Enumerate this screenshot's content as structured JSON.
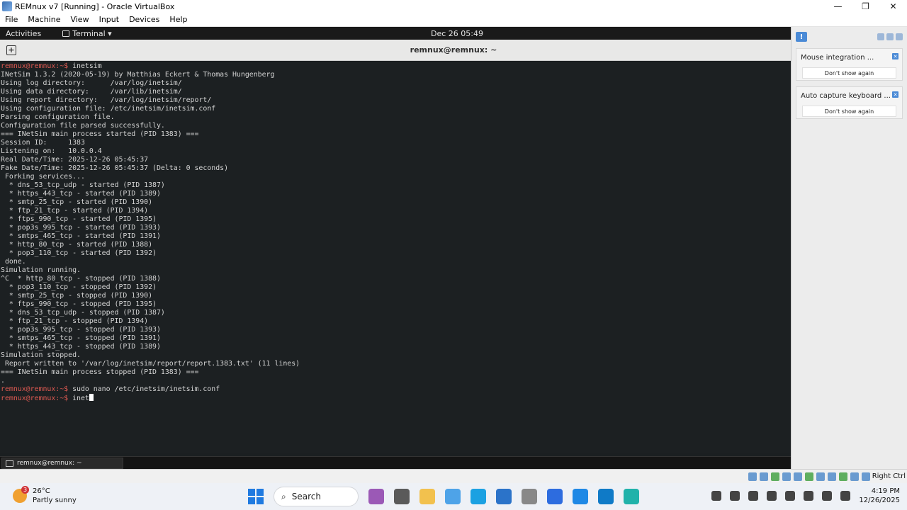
{
  "window": {
    "title": "REMnux v7 [Running] - Oracle VirtualBox",
    "controls": [
      "—",
      "❐",
      "✕"
    ]
  },
  "menubar": [
    "File",
    "Machine",
    "View",
    "Input",
    "Devices",
    "Help"
  ],
  "gnome": {
    "activities": "Activities",
    "app_menu": "Terminal ▾",
    "clock": "Dec 26  05:49"
  },
  "terminal": {
    "title": "remnux@remnux: ~",
    "lines": [
      {
        "prompt": "remnux@remnux:~$",
        "text": " inetsim"
      },
      {
        "prompt": "",
        "text": "INetSim 1.3.2 (2020-05-19) by Matthias Eckert & Thomas Hungenberg"
      },
      {
        "prompt": "",
        "text": "Using log directory:      /var/log/inetsim/"
      },
      {
        "prompt": "",
        "text": "Using data directory:     /var/lib/inetsim/"
      },
      {
        "prompt": "",
        "text": "Using report directory:   /var/log/inetsim/report/"
      },
      {
        "prompt": "",
        "text": "Using configuration file: /etc/inetsim/inetsim.conf"
      },
      {
        "prompt": "",
        "text": "Parsing configuration file."
      },
      {
        "prompt": "",
        "text": "Configuration file parsed successfully."
      },
      {
        "prompt": "",
        "text": "=== INetSim main process started (PID 1383) ==="
      },
      {
        "prompt": "",
        "text": "Session ID:     1383"
      },
      {
        "prompt": "",
        "text": "Listening on:   10.0.0.4"
      },
      {
        "prompt": "",
        "text": "Real Date/Time: 2025-12-26 05:45:37"
      },
      {
        "prompt": "",
        "text": "Fake Date/Time: 2025-12-26 05:45:37 (Delta: 0 seconds)"
      },
      {
        "prompt": "",
        "text": " Forking services..."
      },
      {
        "prompt": "",
        "text": "  * dns_53_tcp_udp - started (PID 1387)"
      },
      {
        "prompt": "",
        "text": "  * https_443_tcp - started (PID 1389)"
      },
      {
        "prompt": "",
        "text": "  * smtp_25_tcp - started (PID 1390)"
      },
      {
        "prompt": "",
        "text": "  * ftp_21_tcp - started (PID 1394)"
      },
      {
        "prompt": "",
        "text": "  * ftps_990_tcp - started (PID 1395)"
      },
      {
        "prompt": "",
        "text": "  * pop3s_995_tcp - started (PID 1393)"
      },
      {
        "prompt": "",
        "text": "  * smtps_465_tcp - started (PID 1391)"
      },
      {
        "prompt": "",
        "text": "  * http_80_tcp - started (PID 1388)"
      },
      {
        "prompt": "",
        "text": "  * pop3_110_tcp - started (PID 1392)"
      },
      {
        "prompt": "",
        "text": " done."
      },
      {
        "prompt": "",
        "text": "Simulation running."
      },
      {
        "prompt": "",
        "text": "^C  * http_80_tcp - stopped (PID 1388)"
      },
      {
        "prompt": "",
        "text": "  * pop3_110_tcp - stopped (PID 1392)"
      },
      {
        "prompt": "",
        "text": "  * smtp_25_tcp - stopped (PID 1390)"
      },
      {
        "prompt": "",
        "text": "  * ftps_990_tcp - stopped (PID 1395)"
      },
      {
        "prompt": "",
        "text": "  * dns_53_tcp_udp - stopped (PID 1387)"
      },
      {
        "prompt": "",
        "text": "  * ftp_21_tcp - stopped (PID 1394)"
      },
      {
        "prompt": "",
        "text": "  * pop3s_995_tcp - stopped (PID 1393)"
      },
      {
        "prompt": "",
        "text": "  * smtps_465_tcp - stopped (PID 1391)"
      },
      {
        "prompt": "",
        "text": "  * https_443_tcp - stopped (PID 1389)"
      },
      {
        "prompt": "",
        "text": "Simulation stopped."
      },
      {
        "prompt": "",
        "text": " Report written to '/var/log/inetsim/report/report.1383.txt' (11 lines)"
      },
      {
        "prompt": "",
        "text": "=== INetSim main process stopped (PID 1383) ==="
      },
      {
        "prompt": "",
        "text": "."
      },
      {
        "prompt": "remnux@remnux:~$",
        "text": " sudo nano /etc/inetsim/inetsim.conf"
      },
      {
        "prompt": "remnux@remnux:~$",
        "text": " inet",
        "cursor": true
      }
    ],
    "taskbar_item": "remnux@remnux: ~"
  },
  "notifications": [
    {
      "title": "Mouse integration ...",
      "dont_show": "Don't show again"
    },
    {
      "title": "Auto capture keyboard ...",
      "dont_show": "Don't show again"
    }
  ],
  "statusbar": {
    "host_key": "Right Ctrl"
  },
  "win_taskbar": {
    "weather_temp": "26°C",
    "weather_desc": "Partly sunny",
    "weather_badge": "3",
    "search_label": "Search",
    "time": "4:19 PM",
    "date": "12/26/2025",
    "pinned_colors": [
      "#9b59b6",
      "#5a5a5a",
      "#f2c14e",
      "#4ea3e8",
      "#1ba1e2",
      "#2b73c9",
      "#888888",
      "#2d6cdf",
      "#1e88e5",
      "#0f7ac7",
      "#20b2aa"
    ],
    "tray_icons": [
      "chevron-up",
      "terminal",
      "app-green",
      "security",
      "mic",
      "wifi",
      "volume",
      "battery"
    ]
  }
}
